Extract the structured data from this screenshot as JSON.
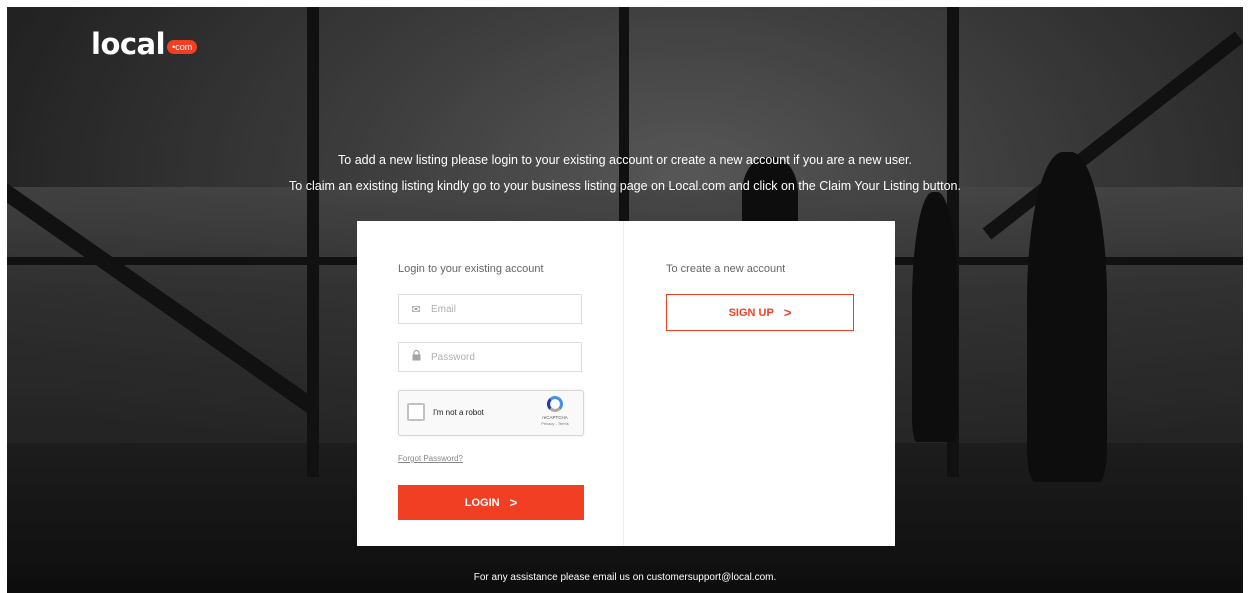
{
  "brand": {
    "name": "local",
    "badge": "•com"
  },
  "info": {
    "line1": "To add a new listing please login to your existing account or create a new account if you are a new user.",
    "line2": "To claim an existing listing kindly go to your business listing page on Local.com and click on the Claim Your Listing button."
  },
  "login": {
    "title": "Login to your existing account",
    "email_placeholder": "Email",
    "password_placeholder": "Password",
    "captcha_label": "I'm not a robot",
    "captcha_brand": "reCAPTCHA",
    "captcha_terms": "Privacy - Terms",
    "forgot_label": "Forgot Password?",
    "login_label": "LOGIN",
    "chevron": ">"
  },
  "signup": {
    "title": "To create a new account",
    "signup_label": "SIGN UP",
    "chevron": ">"
  },
  "footer": {
    "text": "For any assistance please email us on customersupport@local.com."
  },
  "colors": {
    "accent": "#f13f23",
    "background": "#2d2d2d"
  }
}
